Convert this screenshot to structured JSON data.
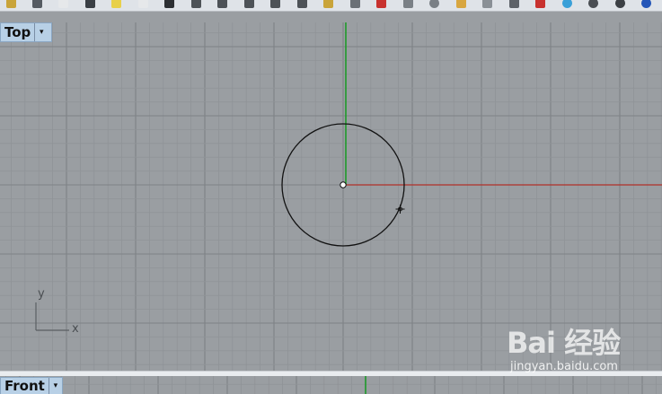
{
  "toolbar": {
    "icons": [
      "save-icon",
      "print-icon",
      "copy-icon",
      "cut-icon",
      "paste-icon",
      "new-file-icon",
      "select-icon",
      "pan-icon",
      "rotate-view-icon",
      "zoom-window-icon",
      "zoom-extents-icon",
      "zoom-selected-icon",
      "zoom-in-icon",
      "four-viewports-icon",
      "car-icon",
      "grid-snap-icon",
      "history-icon",
      "triangle-icon",
      "bulb-icon",
      "layer-icon",
      "book-icon",
      "color-wheel-icon",
      "shaded-sphere-icon",
      "rendered-sphere-icon",
      "globe-icon"
    ],
    "colors": {
      "save-icon": "#c9a43a",
      "print-icon": "#555b62",
      "copy-icon": "#e6e8ea",
      "cut-icon": "#3a3f45",
      "paste-icon": "#e8d04a",
      "new-file-icon": "#e6e8ea",
      "select-icon": "#2c2f33",
      "pan-icon": "#4d5257",
      "rotate-view-icon": "#4d5257",
      "zoom-window-icon": "#4d5257",
      "zoom-extents-icon": "#4d5257",
      "zoom-selected-icon": "#4d5257",
      "zoom-in-icon": "#c9a43a",
      "four-viewports-icon": "#6a7076",
      "car-icon": "#c8322f",
      "grid-snap-icon": "#7a8086",
      "history-icon": "#7a8086",
      "triangle-icon": "#d8a640",
      "bulb-icon": "#8a9096",
      "layer-icon": "#5d6268",
      "book-icon": "#c8322f",
      "color-wheel-icon": "#3aa0d8",
      "shaded-sphere-icon": "#4a4e53",
      "rendered-sphere-icon": "#3c4045",
      "globe-icon": "#2456b8"
    }
  },
  "viewports": {
    "top": {
      "label": "Top",
      "dropdown": "▾"
    },
    "front": {
      "label": "Front",
      "dropdown": "▾"
    }
  },
  "axis_icon": {
    "y_label": "y",
    "x_label": "x"
  },
  "colors": {
    "background": "#9a9ea2",
    "grid_minor": "#8f9397",
    "grid_major": "#7e8286",
    "x_axis": "#b0302a",
    "y_axis": "#1f9a2a",
    "curve": "#111111",
    "tab": "#b8d0e6"
  },
  "watermark": {
    "logo": "Bai 经验",
    "url": "jingyan.baidu.com"
  }
}
